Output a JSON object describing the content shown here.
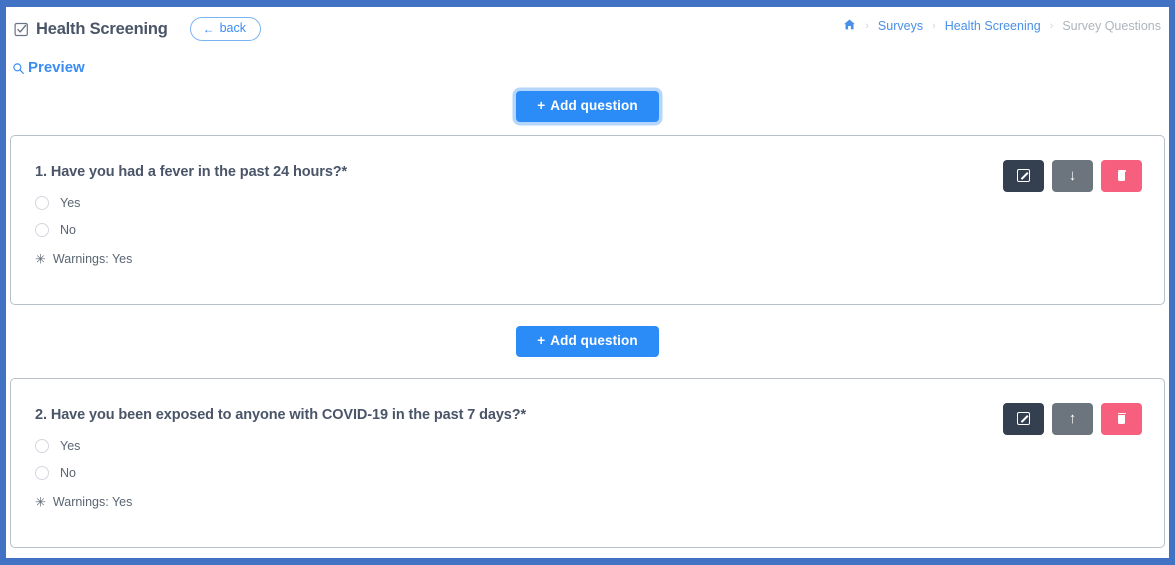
{
  "window": {
    "border_color": "#4272c4"
  },
  "header": {
    "icon": "clipboard-check-icon",
    "title": "Health Screening",
    "back_button": {
      "icon": "left-arrow-icon",
      "label": "back"
    }
  },
  "breadcrumb": {
    "home_icon": "home-icon",
    "separator": "›",
    "items": [
      {
        "label": "Surveys",
        "current": false
      },
      {
        "label": "Health Screening",
        "current": false
      },
      {
        "label": "Survey Questions",
        "current": true
      }
    ]
  },
  "preview": {
    "icon": "magnifier-icon",
    "label": "Preview"
  },
  "add_question": {
    "plus": "+",
    "label": "Add question"
  },
  "actions": {
    "edit_icon": "edit-square-icon",
    "move_down_icon": "arrow-down-icon",
    "move_up_icon": "arrow-up-icon",
    "delete_icon": "trash-icon",
    "edit_color": "#343f4f",
    "move_color": "#6c757d",
    "delete_color": "#f65f7d"
  },
  "questions": [
    {
      "number": "1.",
      "text": "1. Have you had a fever in the past 24 hours?*",
      "options": [
        "Yes",
        "No"
      ],
      "warning_star": "✳",
      "warnings": "Warnings: Yes",
      "move_direction": "down",
      "move_glyph": "↓"
    },
    {
      "number": "2.",
      "text": "2. Have you been exposed to anyone with COVID-19 in the past 7 days?*",
      "options": [
        "Yes",
        "No"
      ],
      "warning_star": "✳",
      "warnings": "Warnings: Yes",
      "move_direction": "up",
      "move_glyph": "↑"
    }
  ]
}
